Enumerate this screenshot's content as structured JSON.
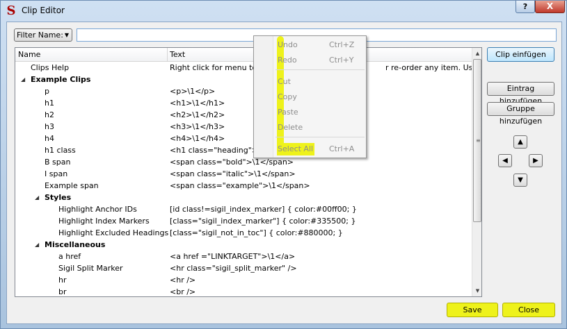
{
  "window": {
    "title": "Clip Editor",
    "help_label": "?",
    "close_label": "X"
  },
  "filter": {
    "button_label": "Filter Name:",
    "input_value": ""
  },
  "tree": {
    "headers": {
      "name": "Name",
      "text": "Text"
    },
    "rows": [
      {
        "name": "Clips Help",
        "text": "Right click for menu to",
        "level": 0,
        "group": false
      },
      {
        "name": "Example Clips",
        "text": "",
        "level": 0,
        "group": true
      },
      {
        "name": "p",
        "text": "<p>\\1</p>",
        "level": 1,
        "group": false
      },
      {
        "name": "h1",
        "text": "<h1>\\1</h1>",
        "level": 1,
        "group": false
      },
      {
        "name": "h2",
        "text": "<h2>\\1</h2>",
        "level": 1,
        "group": false
      },
      {
        "name": "h3",
        "text": "<h3>\\1</h3>",
        "level": 1,
        "group": false
      },
      {
        "name": "h4",
        "text": "<h4>\\1</h4>",
        "level": 1,
        "group": false
      },
      {
        "name": "h1 class",
        "text": "<h1 class=\"heading\">\\",
        "level": 1,
        "group": false
      },
      {
        "name": "B span",
        "text": "<span class=\"bold\">\\1</span>",
        "level": 1,
        "group": false
      },
      {
        "name": "I span",
        "text": "<span class=\"italic\">\\1</span>",
        "level": 1,
        "group": false
      },
      {
        "name": "Example span",
        "text": "<span class=\"example\">\\1</span>",
        "level": 1,
        "group": false
      },
      {
        "name": "Styles",
        "text": "",
        "level": 1,
        "group": true
      },
      {
        "name": "Highlight Anchor IDs",
        "text": "[id class!=sigil_index_marker] { color:#00ff00; }",
        "level": 2,
        "group": false
      },
      {
        "name": "Highlight Index Markers",
        "text": "[class=\"sigil_index_marker\"] { color:#335500; }",
        "level": 2,
        "group": false
      },
      {
        "name": "Highlight Excluded Headings",
        "text": "[class=\"sigil_not_in_toc\"] { color:#880000; }",
        "level": 2,
        "group": false
      },
      {
        "name": "Miscellaneous",
        "text": "",
        "level": 1,
        "group": true
      },
      {
        "name": "a href",
        "text": "<a href =\"LINKTARGET\">\\1</a>",
        "level": 2,
        "group": false
      },
      {
        "name": "Sigil Split Marker",
        "text": "<hr class=\"sigil_split_marker\" />",
        "level": 2,
        "group": false
      },
      {
        "name": "hr",
        "text": "<hr />",
        "level": 2,
        "group": false
      },
      {
        "name": "br",
        "text": "<br />",
        "level": 2,
        "group": false
      }
    ],
    "help_overflow_text": "r re-order any item.   Use ..."
  },
  "buttons": {
    "paste_clip": "Clip einfügen",
    "add_entry": "Eintrag hinzufügen",
    "add_group": "Gruppe hinzufügen",
    "save": "Save",
    "close": "Close"
  },
  "context_menu": {
    "items": [
      {
        "label": "Undo",
        "shortcut": "Ctrl+Z"
      },
      {
        "label": "Redo",
        "shortcut": "Ctrl+Y"
      },
      {
        "label": "Cut",
        "shortcut": ""
      },
      {
        "label": "Copy",
        "shortcut": ""
      },
      {
        "label": "Paste",
        "shortcut": ""
      },
      {
        "label": "Delete",
        "shortcut": ""
      },
      {
        "label": "Select All",
        "shortcut": "Ctrl+A"
      }
    ]
  },
  "colors": {
    "highlight": "#eef21b",
    "title_close": "#c0392b",
    "default_button": "#bee6fd"
  },
  "icons": {
    "app": "sigil-s-icon",
    "up": "arrow-up-icon",
    "down": "arrow-down-icon",
    "left": "arrow-left-icon",
    "right": "arrow-right-icon"
  }
}
